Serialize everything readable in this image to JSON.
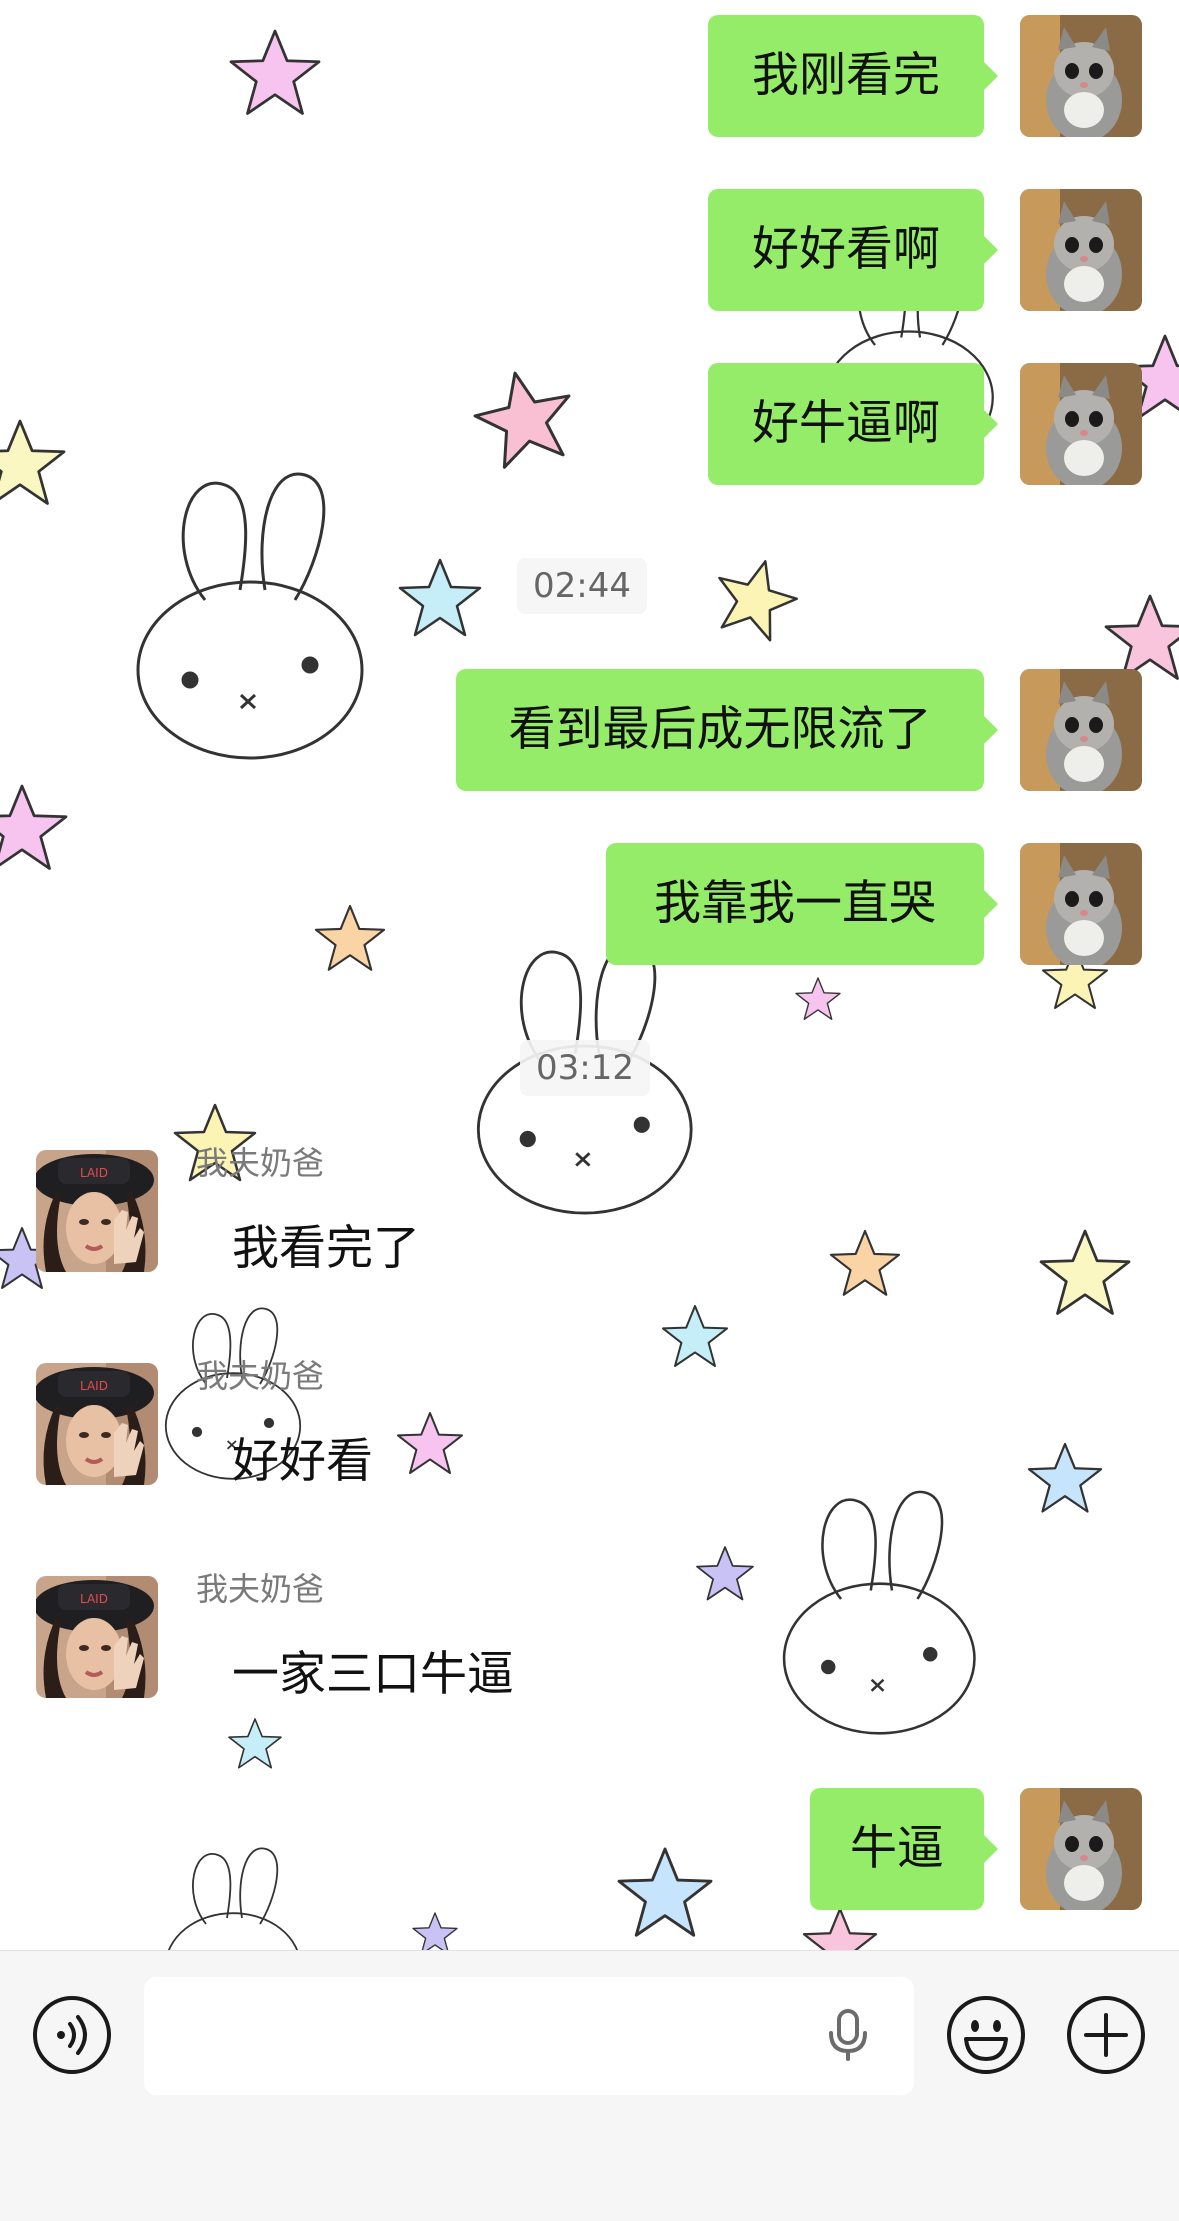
{
  "chat": {
    "messages": [
      {
        "direction": "out",
        "text": "我刚看完"
      },
      {
        "direction": "out",
        "text": "好好看啊"
      },
      {
        "direction": "out",
        "text": "好牛逼啊"
      },
      {
        "type": "timestamp",
        "text": "02:44"
      },
      {
        "direction": "out",
        "text": "看到最后成无限流了"
      },
      {
        "direction": "out",
        "text": "我靠我一直哭"
      },
      {
        "type": "timestamp",
        "text": "03:12"
      },
      {
        "direction": "in",
        "sender": "我夫奶爸",
        "text": "我看完了"
      },
      {
        "direction": "in",
        "sender": "我夫奶爸",
        "text": "好好看"
      },
      {
        "direction": "in",
        "sender": "我夫奶爸",
        "text": "一家三口牛逼"
      },
      {
        "direction": "out",
        "text": "牛逼"
      }
    ]
  },
  "input_bar": {
    "voice_icon": "voice-wave-icon",
    "mic_icon": "microphone-icon",
    "emoji_icon": "smiley-face-icon",
    "more_icon": "plus-circle-icon",
    "text_value": ""
  },
  "colors": {
    "outgoing_bubble": "#95ec69",
    "background": "#ffffff",
    "sender_name": "#7a7a7a"
  },
  "wallpaper": {
    "motifs": [
      "bunny",
      "star"
    ]
  }
}
